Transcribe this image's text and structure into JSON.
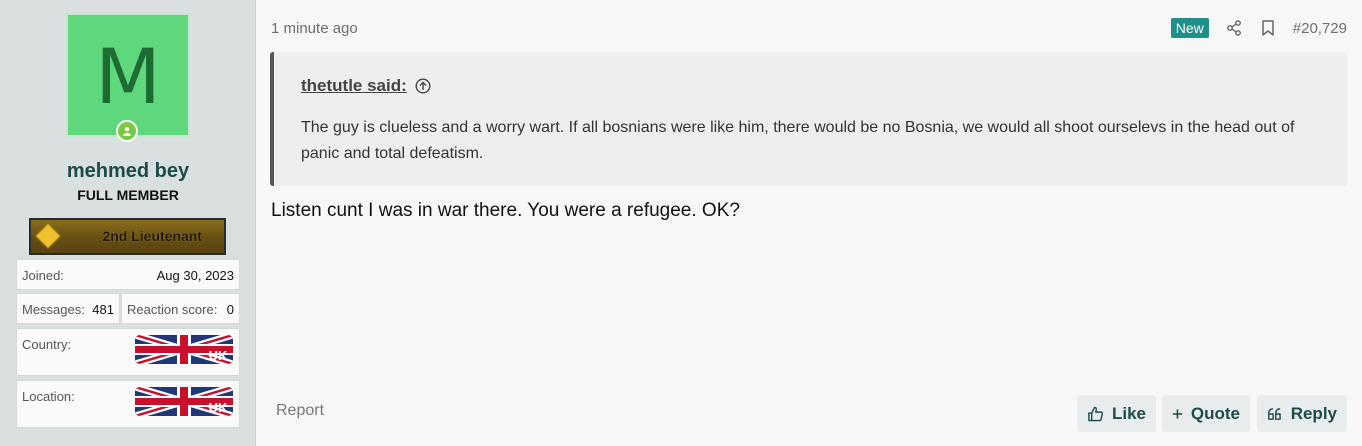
{
  "user": {
    "avatar_letter": "M",
    "name": "mehmed bey",
    "title": "FULL MEMBER",
    "rank": "2nd Lieutenant",
    "joined_label": "Joined:",
    "joined_value": "Aug 30, 2023",
    "messages_label": "Messages:",
    "messages_value": "481",
    "reaction_label": "Reaction score:",
    "reaction_value": "0",
    "country_label": "Country:",
    "location_label": "Location:",
    "flag_text": ".UK"
  },
  "post": {
    "time": "1 minute ago",
    "new_badge": "New",
    "number": "#20,729",
    "quote_author": "thetutle said:",
    "quote_body": "The guy is clueless and a worry wart. If all bosnians were like him, there would be no Bosnia, we would all shoot ourselevs in the head out of panic and total defeatism.",
    "message": "Listen cunt I was in war there. You were a refugee. OK?"
  },
  "actions": {
    "report": "Report",
    "like": "Like",
    "quote": "Quote",
    "reply": "Reply"
  },
  "colors": {
    "accent": "#1e8f8a",
    "link": "#1a4d4a",
    "avatar_bg": "#5fd87d"
  }
}
